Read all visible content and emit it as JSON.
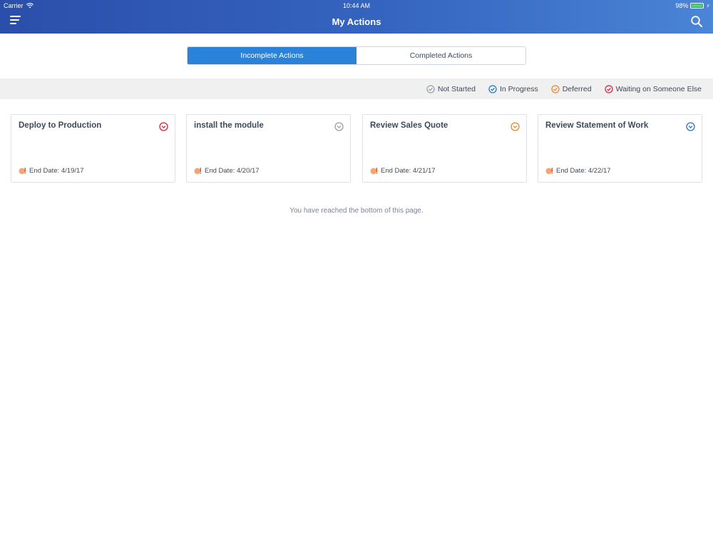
{
  "status_bar": {
    "carrier": "Carrier",
    "time": "10:44 AM",
    "battery": "98%",
    "battery_level": 0.98
  },
  "header": {
    "title": "My Actions",
    "menu_icon": "hamburger-menu-icon",
    "search_icon": "search-icon"
  },
  "tabs": [
    {
      "label": "Incomplete Actions",
      "active": true
    },
    {
      "label": "Completed Actions",
      "active": false
    }
  ],
  "legend": [
    {
      "label": "Not Started",
      "color": "#9aa1aa"
    },
    {
      "label": "In Progress",
      "color": "#2b78c2"
    },
    {
      "label": "Deferred",
      "color": "#f0862d"
    },
    {
      "label": "Waiting on Someone Else",
      "color": "#d6283a"
    }
  ],
  "cards": [
    {
      "title": "Deploy to Production",
      "end_date": "End Date: 4/19/17",
      "status_color": "#d6283a"
    },
    {
      "title": "install the module",
      "end_date": "End Date: 4/20/17",
      "status_color": "#9aa1aa"
    },
    {
      "title": "Review Sales Quote",
      "end_date": "End Date: 4/21/17",
      "status_color": "#f0862d"
    },
    {
      "title": "Review Statement of Work",
      "end_date": "End Date: 4/22/17",
      "status_color": "#2b78c2"
    }
  ],
  "bottom_note": "You have reached the bottom of this page."
}
